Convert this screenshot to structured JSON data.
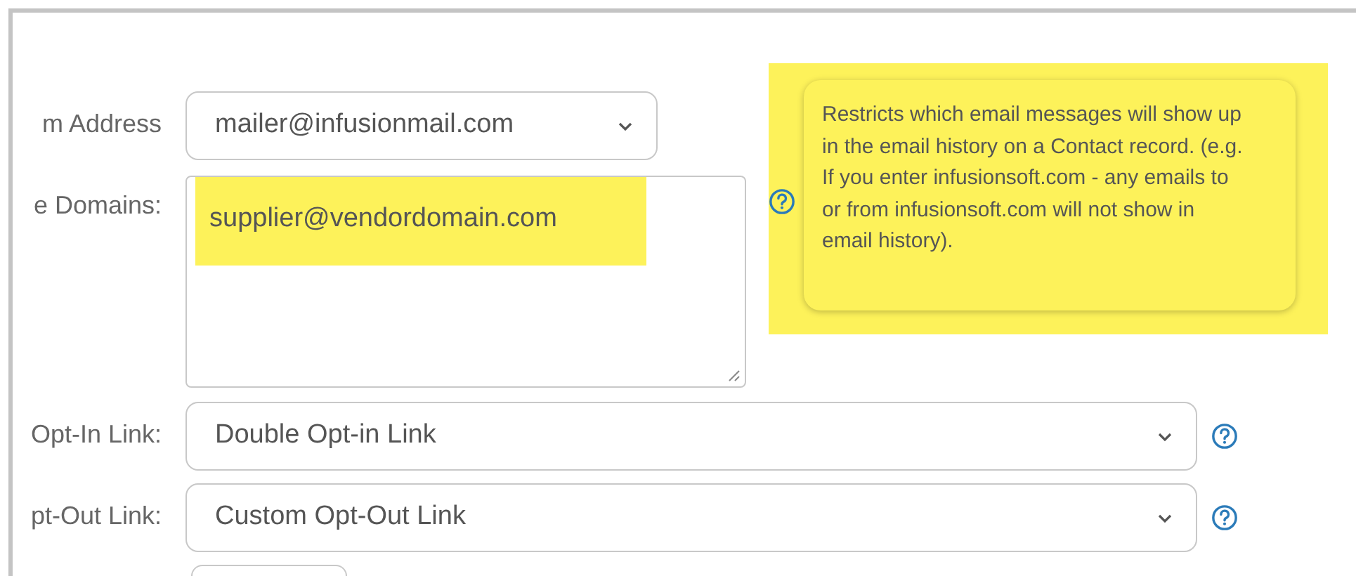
{
  "rows": [
    {
      "kind": "select",
      "label": "m Address",
      "value": "mailer@infusionmail.com",
      "help": false
    },
    {
      "kind": "textarea",
      "label": "e Domains:",
      "value": "supplier@vendordomain.com",
      "highlighted": true,
      "help": true
    },
    {
      "kind": "select",
      "label": "Opt-In Link:",
      "value": "Double Opt-in Link",
      "help": true
    },
    {
      "kind": "select",
      "label": "pt-Out Link:",
      "value": "Custom Opt-Out Link",
      "help": true
    },
    {
      "kind": "partial"
    }
  ],
  "tooltip": {
    "text": "Restricts which email messages will show up in the email history on a Contact record. (e.g. If you enter infusionsoft.com - any emails to or from infusionsoft.com will not show in email history).",
    "highlighted": true
  }
}
